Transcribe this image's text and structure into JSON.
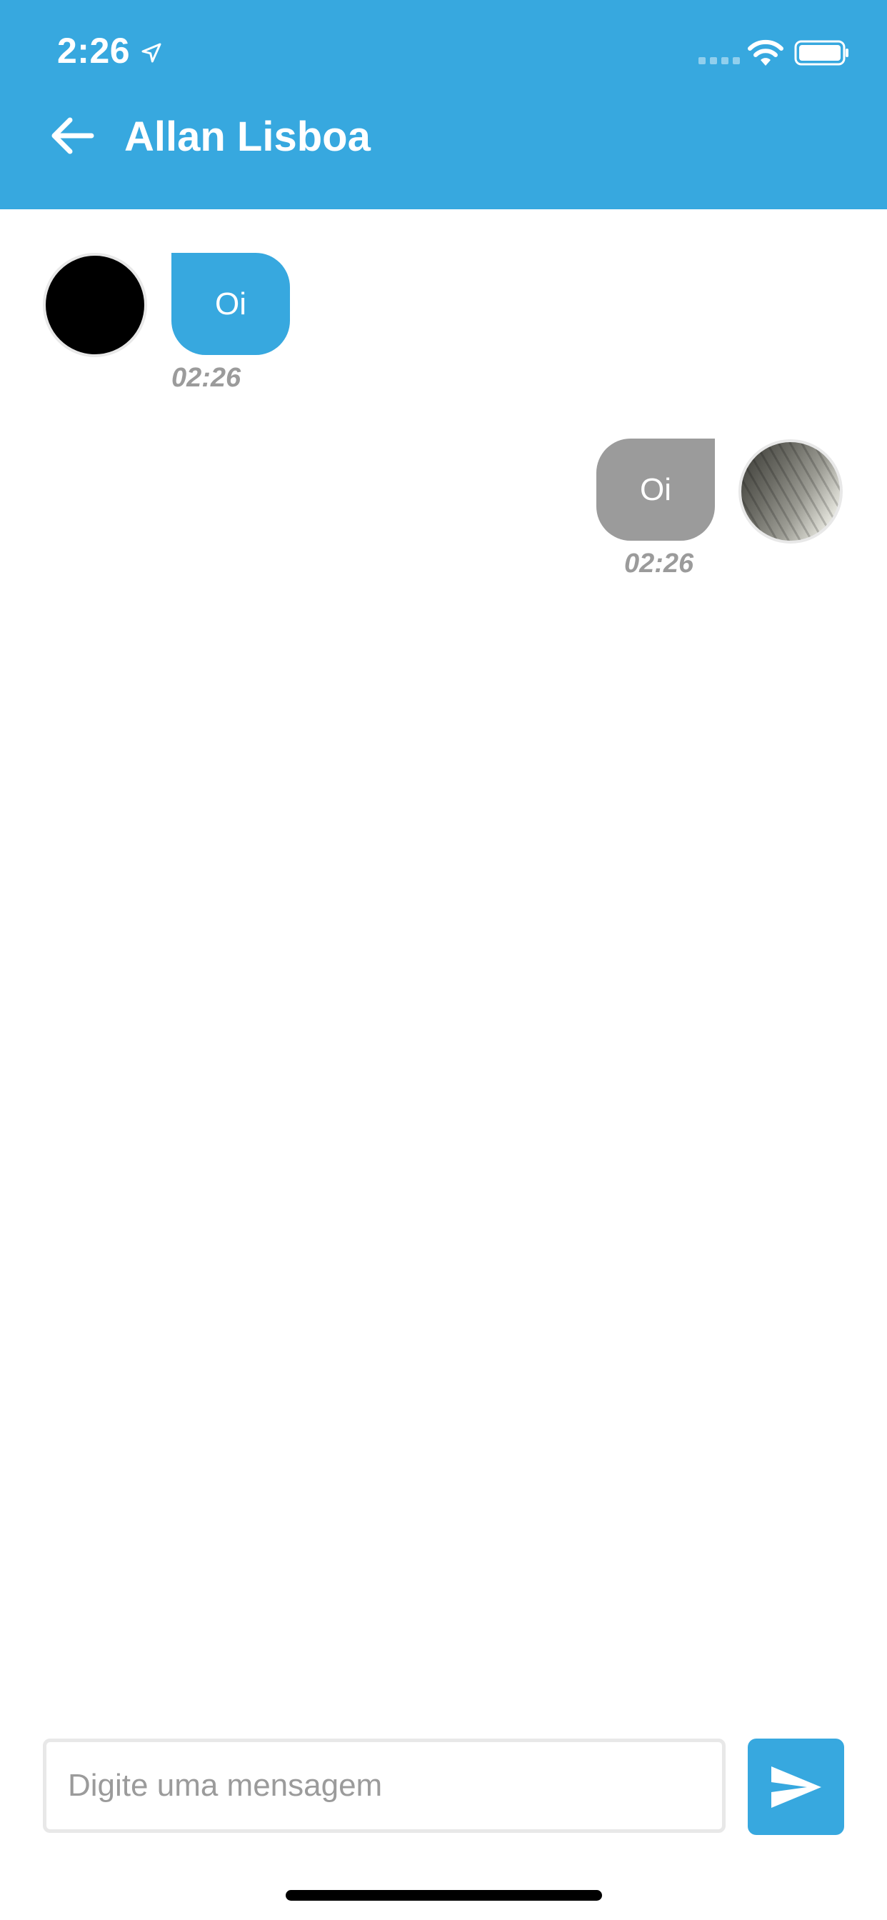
{
  "status_bar": {
    "time": "2:26"
  },
  "header": {
    "title": "Allan Lisboa"
  },
  "messages": [
    {
      "direction": "received",
      "text": "Oi",
      "time": "02:26"
    },
    {
      "direction": "sent",
      "text": "Oi",
      "time": "02:26"
    }
  ],
  "composer": {
    "placeholder": "Digite uma mensagem"
  },
  "icons": {
    "back": "arrow-left-icon",
    "send": "send-icon",
    "location": "location-arrow-icon",
    "wifi": "wifi-icon",
    "battery": "battery-icon"
  },
  "colors": {
    "accent": "#37a8df",
    "sent_bubble": "#9b9b9b",
    "timestamp": "#9b9b9b"
  }
}
